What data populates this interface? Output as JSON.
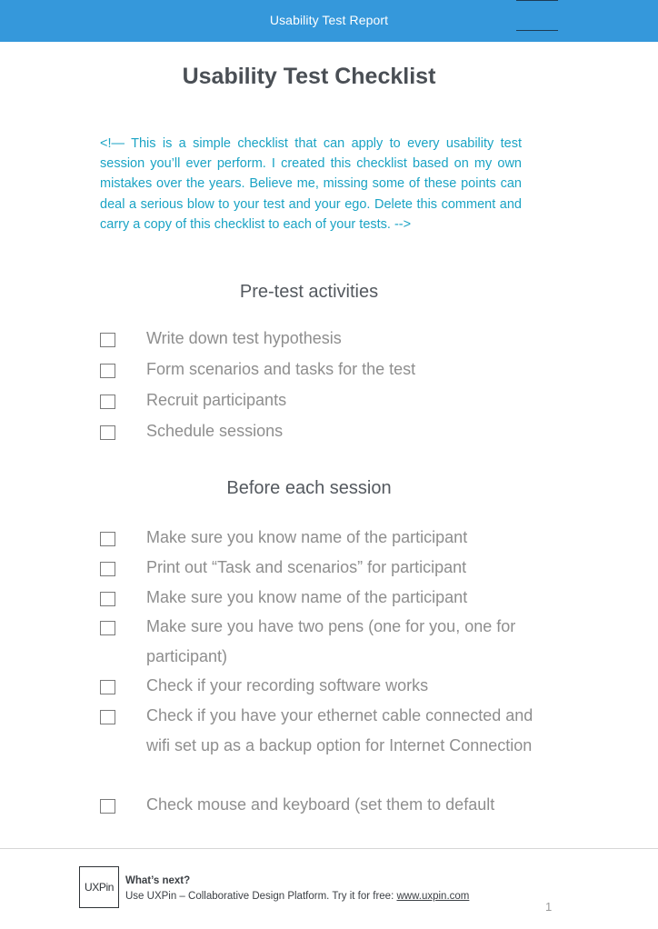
{
  "header": {
    "title": "Usability Test Report",
    "bar_color": "#3598db"
  },
  "document": {
    "title": "Usability Test Checklist",
    "comment": "<!— This is a simple checklist that can apply to every usability test session you’ll ever perform. I created this checklist based on my own mistakes over the years. Believe me, missing some of these points can deal a serious blow to your test and your ego. Delete this comment and carry a copy of this checklist to each of your tests. -->",
    "comment_color": "#1aa3c4"
  },
  "sections": [
    {
      "heading": "Pre-test activities",
      "items": [
        {
          "label": "Write down test hypothesis",
          "checked": false
        },
        {
          "label": "Form scenarios and tasks for the test",
          "checked": false
        },
        {
          "label": "Recruit participants",
          "checked": false
        },
        {
          "label": "Schedule sessions",
          "checked": false
        }
      ]
    },
    {
      "heading": "Before each session",
      "items": [
        {
          "label": "Make sure you know name of the participant",
          "checked": false
        },
        {
          "label": "Print out “Task and scenarios” for participant",
          "checked": false
        },
        {
          "label": "Make sure you know name of the participant",
          "checked": false
        },
        {
          "label": "Make sure you have two pens (one for you, one for participant)",
          "checked": false
        },
        {
          "label": "Check if your recording software works",
          "checked": false
        },
        {
          "label": "Check if you have your ethernet cable connected and wifi set up as a backup option for Internet Connection",
          "checked": false
        },
        {
          "label": "Check mouse and keyboard (set them to default",
          "checked": false
        }
      ]
    }
  ],
  "footer": {
    "logo_text": "UXPin",
    "heading": "What’s next?",
    "text": "Use UXPin – Collaborative Design Platform. Try it for free: ",
    "link_text": "www.uxpin.com",
    "page_number": "1"
  }
}
